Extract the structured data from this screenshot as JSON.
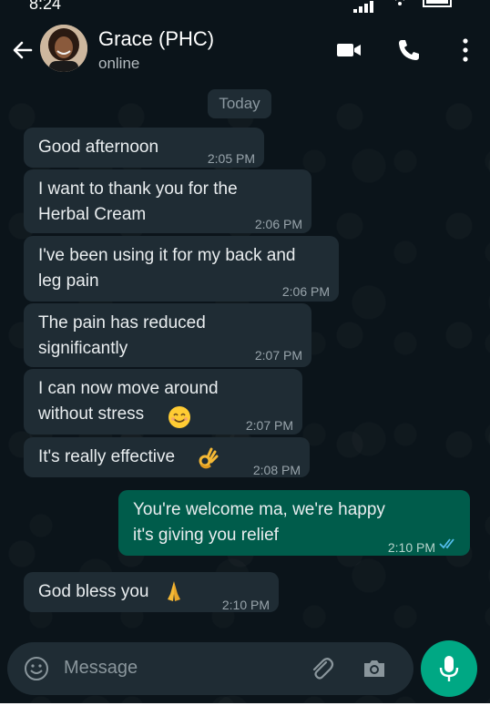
{
  "status_bar": {
    "time": "8:24"
  },
  "header": {
    "contact_name": "Grace (PHC)",
    "contact_status": "online"
  },
  "date_chip": "Today",
  "messages": [
    {
      "direction": "in",
      "text": "Good afternoon",
      "time": "2:05 PM"
    },
    {
      "direction": "in",
      "text": "I want to thank you for the\nHerbal Cream",
      "time": "2:06 PM"
    },
    {
      "direction": "in",
      "text": "I've been using it for my back and\nleg pain",
      "time": "2:06 PM"
    },
    {
      "direction": "in",
      "text": "The pain has reduced\nsignificantly",
      "time": "2:07 PM"
    },
    {
      "direction": "in",
      "text": "I can now move around\nwithout stress",
      "emoji": "smiling-face-icon",
      "time": "2:07 PM"
    },
    {
      "direction": "in",
      "text": "It's really effective",
      "emoji": "ok-hand-icon",
      "time": "2:08 PM"
    },
    {
      "direction": "out",
      "text": "You're welcome ma, we're happy\nit's giving you relief",
      "time": "2:10 PM",
      "status": "read"
    },
    {
      "direction": "in",
      "text": "God bless you",
      "emoji": "folded-hands-icon",
      "time": "2:10 PM"
    }
  ],
  "composer": {
    "placeholder": "Message"
  },
  "colors": {
    "background": "#0b141a",
    "incoming_bubble": "#1f2c34",
    "outgoing_bubble": "#005c4b",
    "accent": "#00a884",
    "read_ticks": "#53bdeb"
  }
}
